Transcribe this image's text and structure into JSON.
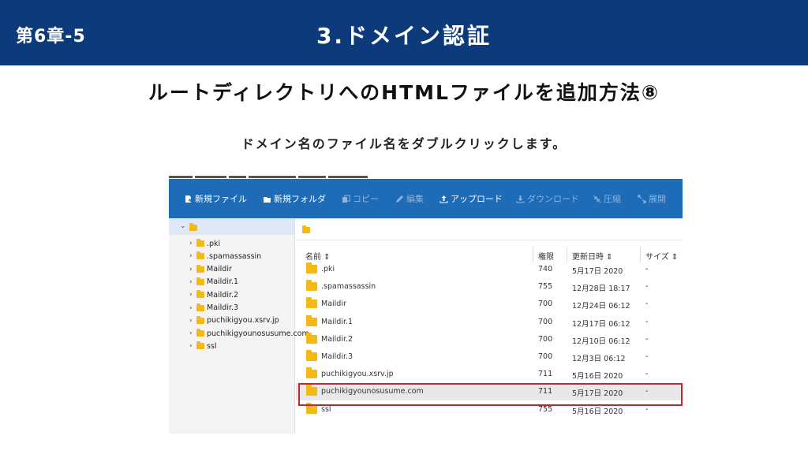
{
  "header": {
    "chapter": "第6章-5",
    "title": "3.ドメイン認証",
    "bg_color": "#0d3a7b"
  },
  "heading": "ルートディレクトリへのHTMLファイルを追加方法⑧",
  "subheading": "ドメイン名のファイル名をダブルクリックします。",
  "toolbar": {
    "new_file": "新規ファイル",
    "new_folder": "新規フォルダ",
    "copy": "コピー",
    "edit": "編集",
    "upload": "アップロード",
    "download": "ダウンロード",
    "compress": "圧縮",
    "extract": "展開",
    "color": "#1e6bb8"
  },
  "tree": {
    "items": [
      ".pki",
      ".spamassassin",
      "Maildir",
      "Maildir.1",
      "Maildir.2",
      "Maildir.3",
      "puchikigyou.xsrv.jp",
      "puchikigyounosusume.com",
      "ssl"
    ]
  },
  "columns": {
    "name": "名前 ⇕",
    "perm": "権限",
    "date": "更新日時 ⇕",
    "size": "サイズ ⇕"
  },
  "files": [
    {
      "name": ".pki",
      "perm": "740",
      "date": "5月17日 2020",
      "size": "-"
    },
    {
      "name": ".spamassassin",
      "perm": "755",
      "date": "12月28日 18:17",
      "size": "-"
    },
    {
      "name": "Maildir",
      "perm": "700",
      "date": "12月24日 06:12",
      "size": "-"
    },
    {
      "name": "Maildir.1",
      "perm": "700",
      "date": "12月17日 06:12",
      "size": "-"
    },
    {
      "name": "Maildir.2",
      "perm": "700",
      "date": "12月10日 06:12",
      "size": "-"
    },
    {
      "name": "Maildir.3",
      "perm": "700",
      "date": "12月3日 06:12",
      "size": "-"
    },
    {
      "name": "puchikigyou.xsrv.jp",
      "perm": "711",
      "date": "5月16日 2020",
      "size": "-"
    },
    {
      "name": "puchikigyounosusume.com",
      "perm": "711",
      "date": "5月17日 2020",
      "size": "-"
    },
    {
      "name": "ssl",
      "perm": "755",
      "date": "5月16日 2020",
      "size": "-"
    }
  ],
  "highlight_color": "#c0272d"
}
